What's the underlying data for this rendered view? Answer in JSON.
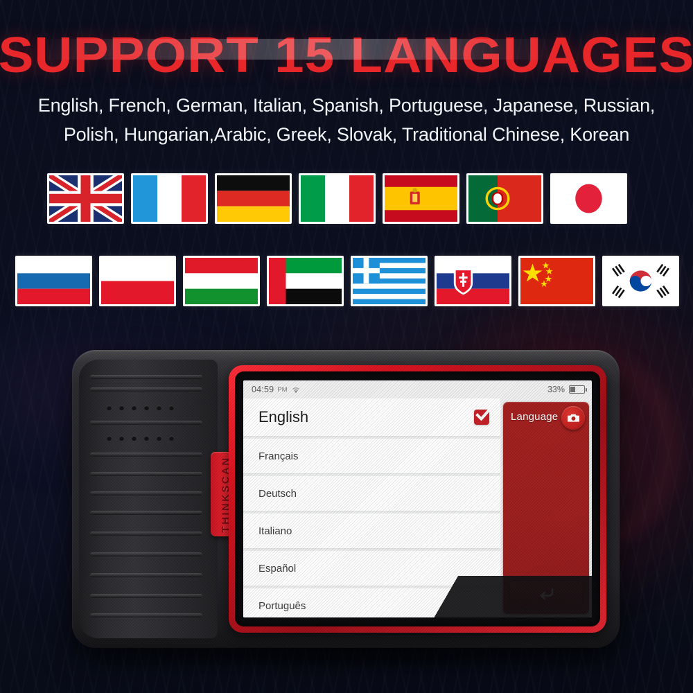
{
  "header": {
    "title": "SUPPORT 15 LANGUAGES",
    "subtitle_line1": "English, French, German, Italian, Spanish, Portuguese, Japanese, Russian,",
    "subtitle_line2": "Polish, Hungarian,Arabic, Greek, Slovak, Traditional Chinese, Korean",
    "title_color": "#e8272b",
    "background_color": "#0a0d1c"
  },
  "flags": {
    "row1": [
      {
        "name": "united-kingdom",
        "label": "English"
      },
      {
        "name": "france",
        "label": "French"
      },
      {
        "name": "germany",
        "label": "German"
      },
      {
        "name": "italy",
        "label": "Italian"
      },
      {
        "name": "spain",
        "label": "Spanish"
      },
      {
        "name": "portugal",
        "label": "Portuguese"
      },
      {
        "name": "japan",
        "label": "Japanese"
      }
    ],
    "row2": [
      {
        "name": "russia",
        "label": "Russian"
      },
      {
        "name": "poland",
        "label": "Polish"
      },
      {
        "name": "hungary",
        "label": "Hungarian"
      },
      {
        "name": "united-arab-emirates",
        "label": "Arabic"
      },
      {
        "name": "greece",
        "label": "Greek"
      },
      {
        "name": "slovakia",
        "label": "Slovak"
      },
      {
        "name": "china",
        "label": "Traditional Chinese"
      },
      {
        "name": "south-korea",
        "label": "Korean"
      }
    ]
  },
  "device": {
    "brand": "THINKSCAN",
    "accent_color": "#e6202c",
    "body_color": "#2a2a2e"
  },
  "screen": {
    "statusbar": {
      "time": "04:59",
      "ampm": "PM",
      "wifi_icon": "wifi-icon",
      "battery_percent": "33%",
      "battery_level": 33,
      "battery_icon": "battery-icon"
    },
    "language_list": [
      {
        "label": "English",
        "selected": true
      },
      {
        "label": "Français",
        "selected": false
      },
      {
        "label": "Deutsch",
        "selected": false
      },
      {
        "label": "Italiano",
        "selected": false
      },
      {
        "label": "Español",
        "selected": false
      },
      {
        "label": "Português",
        "selected": false
      }
    ],
    "panel": {
      "title": "Language",
      "camera_icon": "camera-icon",
      "back_icon": "back-arrow-icon",
      "panel_color": "#9e2020"
    }
  }
}
